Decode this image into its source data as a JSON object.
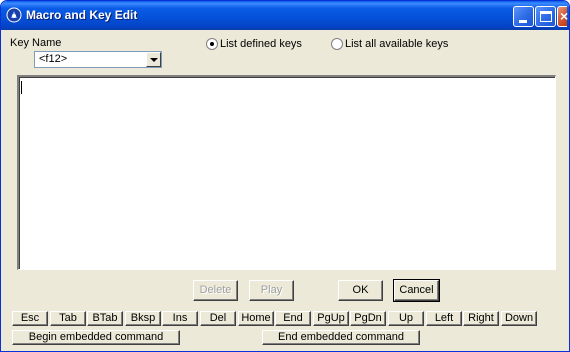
{
  "window": {
    "title": "Macro and Key Edit",
    "controls": {
      "minimize": "",
      "maximize": "",
      "close": "×"
    }
  },
  "key_name": {
    "label": "Key Name",
    "selected": "<f12>"
  },
  "list_options": [
    {
      "label": "List defined keys",
      "selected": true
    },
    {
      "label": "List all available keys",
      "selected": false
    }
  ],
  "editor": {
    "value": ""
  },
  "actions": {
    "delete": "Delete",
    "play": "Play",
    "ok": "OK",
    "cancel": "Cancel"
  },
  "keys": [
    "Esc",
    "Tab",
    "BTab",
    "Bksp",
    "Ins",
    "Del",
    "Home",
    "End",
    "PgUp",
    "PgDn",
    "Up",
    "Left",
    "Right",
    "Down"
  ],
  "commands": {
    "begin": "Begin embedded command",
    "end": "End embedded command"
  },
  "colors": {
    "titlebar": "#0a5ce6",
    "face": "#ece9d8",
    "close": "#c23b18"
  }
}
